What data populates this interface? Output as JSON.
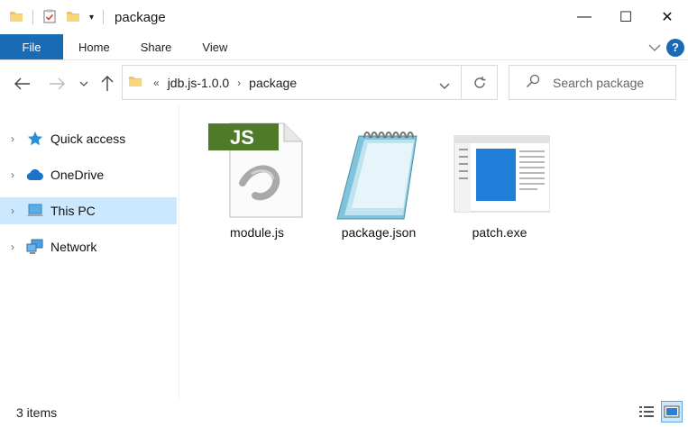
{
  "window": {
    "title": "package",
    "controls": {
      "minimize": "—",
      "maximize": "☐",
      "close": "✕"
    }
  },
  "ribbon": {
    "tabs": [
      {
        "label": "File"
      },
      {
        "label": "Home"
      },
      {
        "label": "Share"
      },
      {
        "label": "View"
      }
    ],
    "help_label": "?"
  },
  "address": {
    "overflow": "«",
    "breadcrumbs": [
      "jdb.js-1.0.0",
      "package"
    ]
  },
  "search": {
    "placeholder": "Search package"
  },
  "navpane": {
    "items": [
      {
        "label": "Quick access",
        "icon": "star-icon"
      },
      {
        "label": "OneDrive",
        "icon": "cloud-icon"
      },
      {
        "label": "This PC",
        "icon": "computer-icon",
        "selected": true
      },
      {
        "label": "Network",
        "icon": "network-icon"
      }
    ]
  },
  "files": [
    {
      "name": "module.js",
      "icon": "js-file-icon",
      "badge": "JS"
    },
    {
      "name": "package.json",
      "icon": "notepad-icon"
    },
    {
      "name": "patch.exe",
      "icon": "exe-app-icon"
    }
  ],
  "status": {
    "count": "3 items"
  },
  "colors": {
    "accent": "#1a6bb5",
    "selection": "#cce8ff",
    "folder": "#f2c55c"
  }
}
